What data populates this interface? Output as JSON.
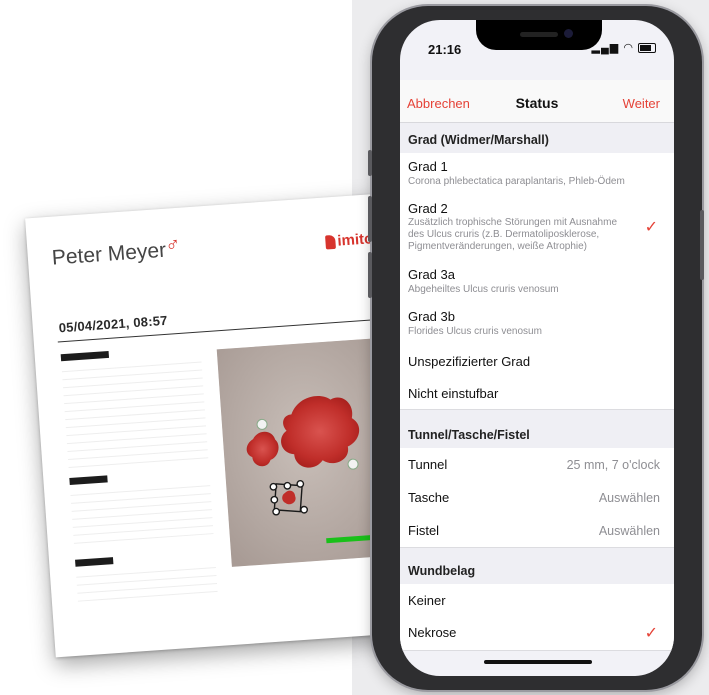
{
  "report": {
    "patient_name": "Peter Meyer",
    "gender_symbol": "♂",
    "logo_text": "imito",
    "datetime": "05/04/2021, 08:57"
  },
  "phone": {
    "status_time": "21:16",
    "nav": {
      "cancel": "Abbrechen",
      "title": "Status",
      "next": "Weiter"
    },
    "sections": {
      "grad_header": "Grad (Widmer/Marshall)",
      "tunnel_header": "Tunnel/Tasche/Fistel",
      "wundbelag_header": "Wundbelag"
    },
    "grad_items": [
      {
        "title": "Grad 1",
        "subtitle": "Corona phlebectatica paraplantaris, Phleb-Ödem"
      },
      {
        "title": "Grad 2",
        "subtitle_lines": [
          "Zusätzlich trophische Störungen mit Ausnahme",
          "des Ulcus cruris (z.B. Dermatoliposklerose,",
          "Pigmentveränderungen, weiße Atrophie)"
        ],
        "checked": true
      },
      {
        "title": "Grad 3a",
        "subtitle": "Abgeheiltes Ulcus cruris venosum"
      },
      {
        "title": "Grad 3b",
        "subtitle": "Florides Ulcus cruris venosum"
      },
      {
        "title": "Unspezifizierter Grad"
      },
      {
        "title": "Nicht einstufbar"
      }
    ],
    "tunnel_items": [
      {
        "title": "Tunnel",
        "value": "25 mm, 7 o'clock"
      },
      {
        "title": "Tasche",
        "value": "Auswählen"
      },
      {
        "title": "Fistel",
        "value": "Auswählen"
      }
    ],
    "wundbelag_items": [
      {
        "title": "Keiner"
      },
      {
        "title": "Nekrose",
        "checked": true
      }
    ],
    "checkmark": "✓"
  },
  "colors": {
    "accent": "#e54237",
    "scale_bar": "#19c019",
    "wound": "#c9302c"
  }
}
